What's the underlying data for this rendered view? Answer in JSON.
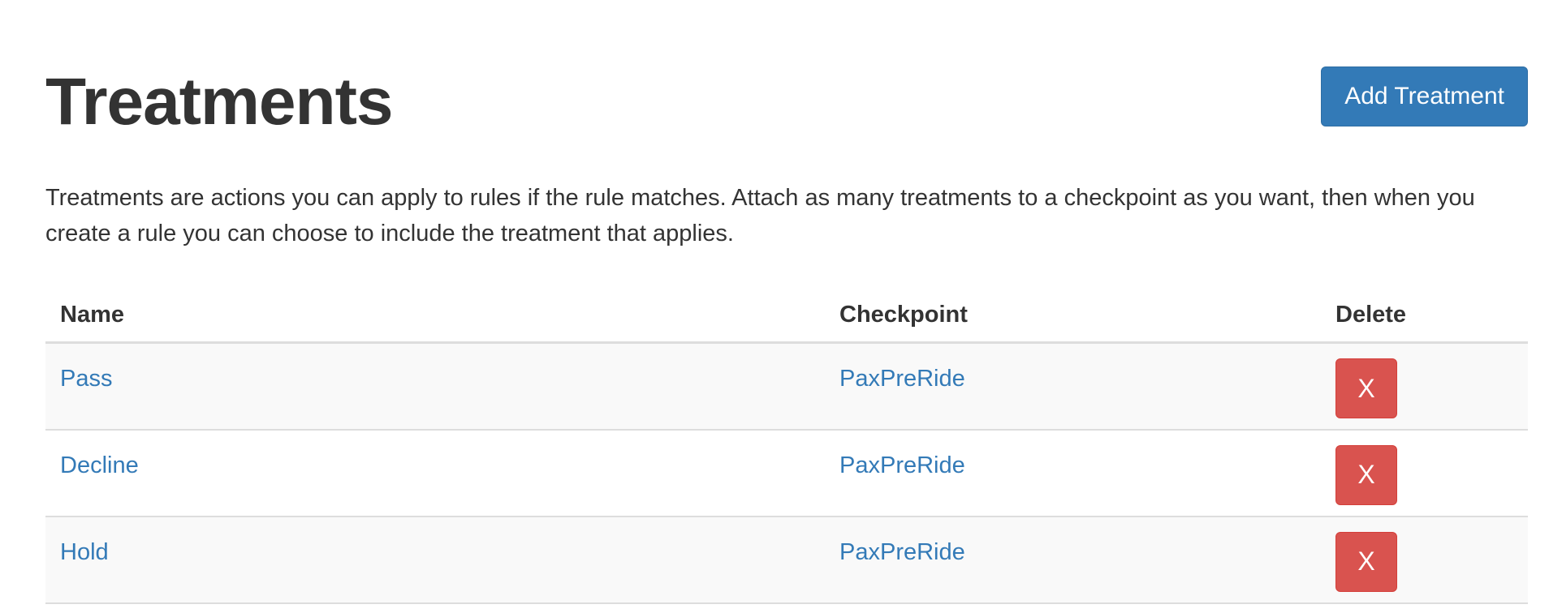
{
  "page": {
    "title": "Treatments",
    "add_button_label": "Add Treatment",
    "description": "Treatments are actions you can apply to rules if the rule matches. Attach as many treatments to a checkpoint as you want, then when you create a rule you can choose to include the treatment that applies."
  },
  "table": {
    "headers": {
      "name": "Name",
      "checkpoint": "Checkpoint",
      "delete": "Delete"
    },
    "rows": [
      {
        "name": "Pass",
        "checkpoint": "PaxPreRide",
        "delete_label": "X"
      },
      {
        "name": "Decline",
        "checkpoint": "PaxPreRide",
        "delete_label": "X"
      },
      {
        "name": "Hold",
        "checkpoint": "PaxPreRide",
        "delete_label": "X"
      }
    ]
  },
  "colors": {
    "primary": "#337ab7",
    "danger": "#d9534f",
    "text": "#333333",
    "row_stripe": "#f9f9f9",
    "border": "#dddddd"
  }
}
